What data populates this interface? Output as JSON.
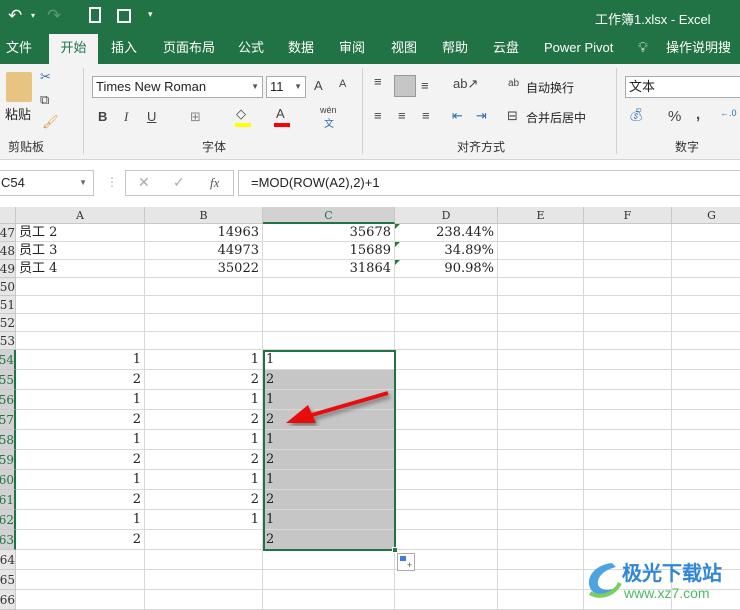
{
  "title": "工作簿1.xlsx  -  Excel",
  "quick_access": [
    "undo-icon",
    "redo-icon",
    "print-preview-icon",
    "save-icon",
    "customize-icon"
  ],
  "tabs": [
    "文件",
    "开始",
    "插入",
    "页面布局",
    "公式",
    "数据",
    "审阅",
    "视图",
    "帮助",
    "云盘",
    "Power Pivot",
    "操作说明搜索"
  ],
  "active_tab": "开始",
  "ribbon": {
    "clipboard": {
      "paste": "粘贴",
      "label": "剪贴板"
    },
    "font": {
      "name": "Times New Roman",
      "size": "11",
      "label": "字体",
      "bold": "B",
      "italic": "I",
      "underline": "U",
      "grow": "A",
      "shrink": "A",
      "phonetic_top": "wén",
      "phonetic_bottom": "文",
      "fill_color": "#ffff00",
      "font_color": "#ff0000"
    },
    "alignment": {
      "wrap": "自动换行",
      "merge": "合并后居中",
      "label": "对齐方式"
    },
    "number": {
      "format": "文本",
      "percent": "%",
      "comma": ",",
      "label": "数字"
    }
  },
  "formula_bar": {
    "name_box": "C54",
    "fx": "fx",
    "formula": "=MOD(ROW(A2),2)+1"
  },
  "columns": [
    "A",
    "B",
    "C",
    "D",
    "E",
    "F",
    "G"
  ],
  "selected_column": "C",
  "rows": [
    {
      "n": "47",
      "A": "员工 2",
      "B": "14963",
      "C": "35678",
      "D": "238.44%"
    },
    {
      "n": "48",
      "A": "员工 3",
      "B": "44973",
      "C": "15689",
      "D": "34.89%"
    },
    {
      "n": "49",
      "A": "员工 4",
      "B": "35022",
      "C": "31864",
      "D": "90.98%"
    },
    {
      "n": "50"
    },
    {
      "n": "51"
    },
    {
      "n": "52"
    },
    {
      "n": "53"
    },
    {
      "n": "54",
      "A": "1",
      "B": "1",
      "C": "1"
    },
    {
      "n": "55",
      "A": "2",
      "B": "2",
      "C": "2"
    },
    {
      "n": "56",
      "A": "1",
      "B": "1",
      "C": "1"
    },
    {
      "n": "57",
      "A": "2",
      "B": "2",
      "C": "2"
    },
    {
      "n": "58",
      "A": "1",
      "B": "1",
      "C": "1"
    },
    {
      "n": "59",
      "A": "2",
      "B": "2",
      "C": "2"
    },
    {
      "n": "60",
      "A": "1",
      "B": "1",
      "C": "1"
    },
    {
      "n": "61",
      "A": "2",
      "B": "2",
      "C": "2"
    },
    {
      "n": "62",
      "A": "1",
      "B": "1",
      "C": "1"
    },
    {
      "n": "63",
      "A": "2",
      "C": "2"
    },
    {
      "n": "64"
    },
    {
      "n": "65"
    },
    {
      "n": "66"
    }
  ],
  "selection": "C54:C63",
  "accent": "#217346",
  "watermark": {
    "name": "极光下载站",
    "url": "www.xz7.com"
  }
}
